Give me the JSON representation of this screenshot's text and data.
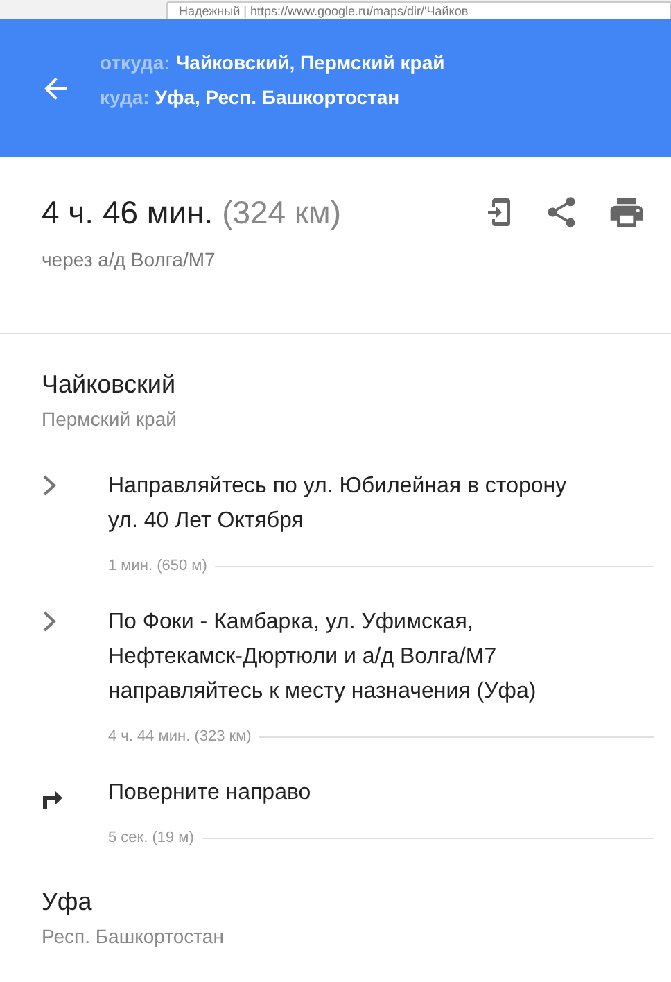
{
  "browser": {
    "address": "Надежный | https://www.google.ru/maps/dir/'Чайков"
  },
  "header": {
    "from_label": "откуда:",
    "from": "Чайковский, Пермский край",
    "to_label": "куда:",
    "to": "Уфа, Респ. Башкортостан"
  },
  "summary": {
    "duration": "4 ч. 46 мин.",
    "distance": "(324 км)",
    "via": "через а/д Волга/М7"
  },
  "origin": {
    "name": "Чайковский",
    "region": "Пермский край"
  },
  "steps": [
    {
      "kind": "continue",
      "text": "Направляйтесь по ул. Юбилейная в сторону ул. 40 Лет Октября",
      "distance": "1 мин. (650 м)"
    },
    {
      "kind": "continue",
      "text": "По Фоки - Камбарка, ул. Уфимская, Нефтекамск-Дюртюли и а/д Волга/М7 направляйтесь к месту назначения (Уфа)",
      "distance": "4 ч. 44 мин. (323 км)"
    },
    {
      "kind": "turn-right",
      "text": "Поверните направо",
      "distance": "5 сек. (19 м)"
    }
  ],
  "destination": {
    "name": "Уфа",
    "region": "Респ. Башкортостан"
  }
}
